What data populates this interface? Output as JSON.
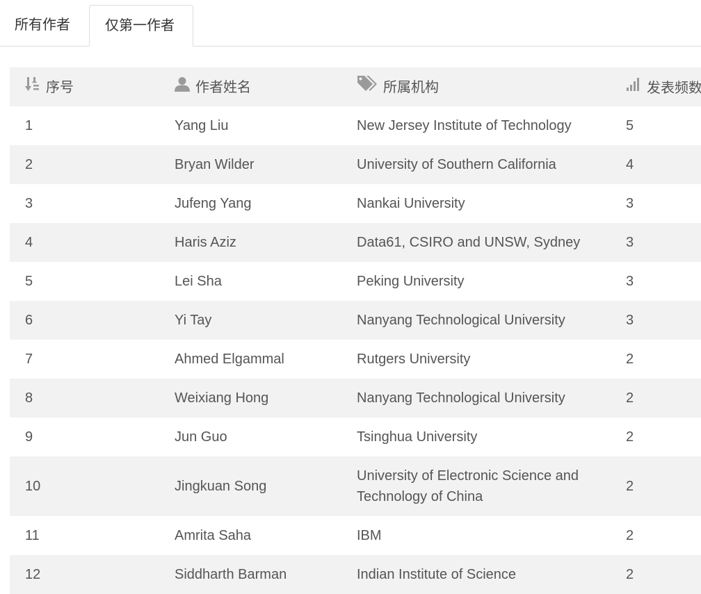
{
  "tabs": [
    {
      "label": "所有作者"
    },
    {
      "label": "仅第一作者"
    }
  ],
  "table": {
    "headers": {
      "index": "序号",
      "name": "作者姓名",
      "affiliation": "所属机构",
      "count": "发表频数"
    },
    "rows": [
      {
        "index": "1",
        "name": "Yang Liu",
        "affiliation": "New Jersey Institute of Technology",
        "count": "5"
      },
      {
        "index": "2",
        "name": "Bryan Wilder",
        "affiliation": "University of Southern California",
        "count": "4"
      },
      {
        "index": "3",
        "name": "Jufeng Yang",
        "affiliation": "Nankai University",
        "count": "3"
      },
      {
        "index": "4",
        "name": "Haris Aziz",
        "affiliation": "Data61, CSIRO and UNSW, Sydney",
        "count": "3"
      },
      {
        "index": "5",
        "name": "Lei Sha",
        "affiliation": "Peking University",
        "count": "3"
      },
      {
        "index": "6",
        "name": "Yi Tay",
        "affiliation": "Nanyang Technological University",
        "count": "3"
      },
      {
        "index": "7",
        "name": "Ahmed Elgammal",
        "affiliation": "Rutgers University",
        "count": "2"
      },
      {
        "index": "8",
        "name": "Weixiang Hong",
        "affiliation": "Nanyang Technological University",
        "count": "2"
      },
      {
        "index": "9",
        "name": "Jun Guo",
        "affiliation": "Tsinghua University",
        "count": "2"
      },
      {
        "index": "10",
        "name": "Jingkuan Song",
        "affiliation": "University of Electronic Science and Technology of China",
        "count": "2"
      },
      {
        "index": "11",
        "name": "Amrita Saha",
        "affiliation": "IBM",
        "count": "2"
      },
      {
        "index": "12",
        "name": "Siddharth Barman",
        "affiliation": "Indian Institute of Science",
        "count": "2"
      }
    ]
  },
  "icons": {
    "index": "sort-numeric-icon",
    "name": "user-icon",
    "affiliation": "tags-icon",
    "count": "signal-bars-icon"
  },
  "colors": {
    "text": "#555555",
    "stripe": "#f2f2f2",
    "border": "#dddddd",
    "icon": "#9a9a9a"
  }
}
